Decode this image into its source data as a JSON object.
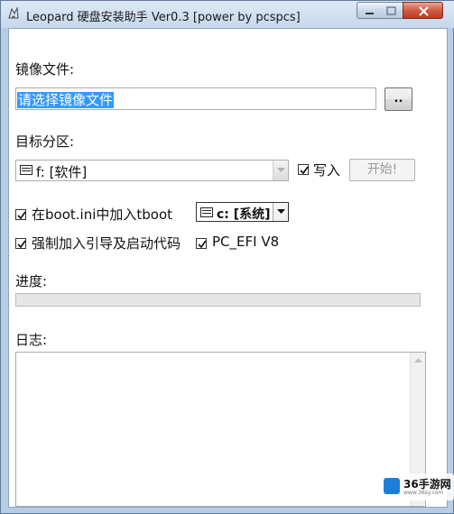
{
  "window": {
    "title": "Leopard 硬盘安装助手 Ver0.3 [power by pcspcs]",
    "accent": "#c4d7ee"
  },
  "image_file": {
    "label": "镜像文件:",
    "value": "请选择镜像文件",
    "browse_label": ".."
  },
  "target": {
    "label": "目标分区:",
    "selected": "f: [软件]",
    "write_checked": true,
    "write_label": "写入",
    "start_label": "开始!"
  },
  "options": {
    "boot_ini_checked": true,
    "boot_ini_label": "在boot.ini中加入tboot",
    "boot_drive": "c: [系统]",
    "force_boot_checked": true,
    "force_boot_label": "强制加入引导及启动代码",
    "pc_efi_checked": true,
    "pc_efi_label": "PC_EFI V8"
  },
  "progress": {
    "label": "进度:",
    "value": 0
  },
  "log": {
    "label": "日志:",
    "content": ""
  },
  "watermark": {
    "text": "36手游网",
    "sub": "www.36sy.com"
  }
}
